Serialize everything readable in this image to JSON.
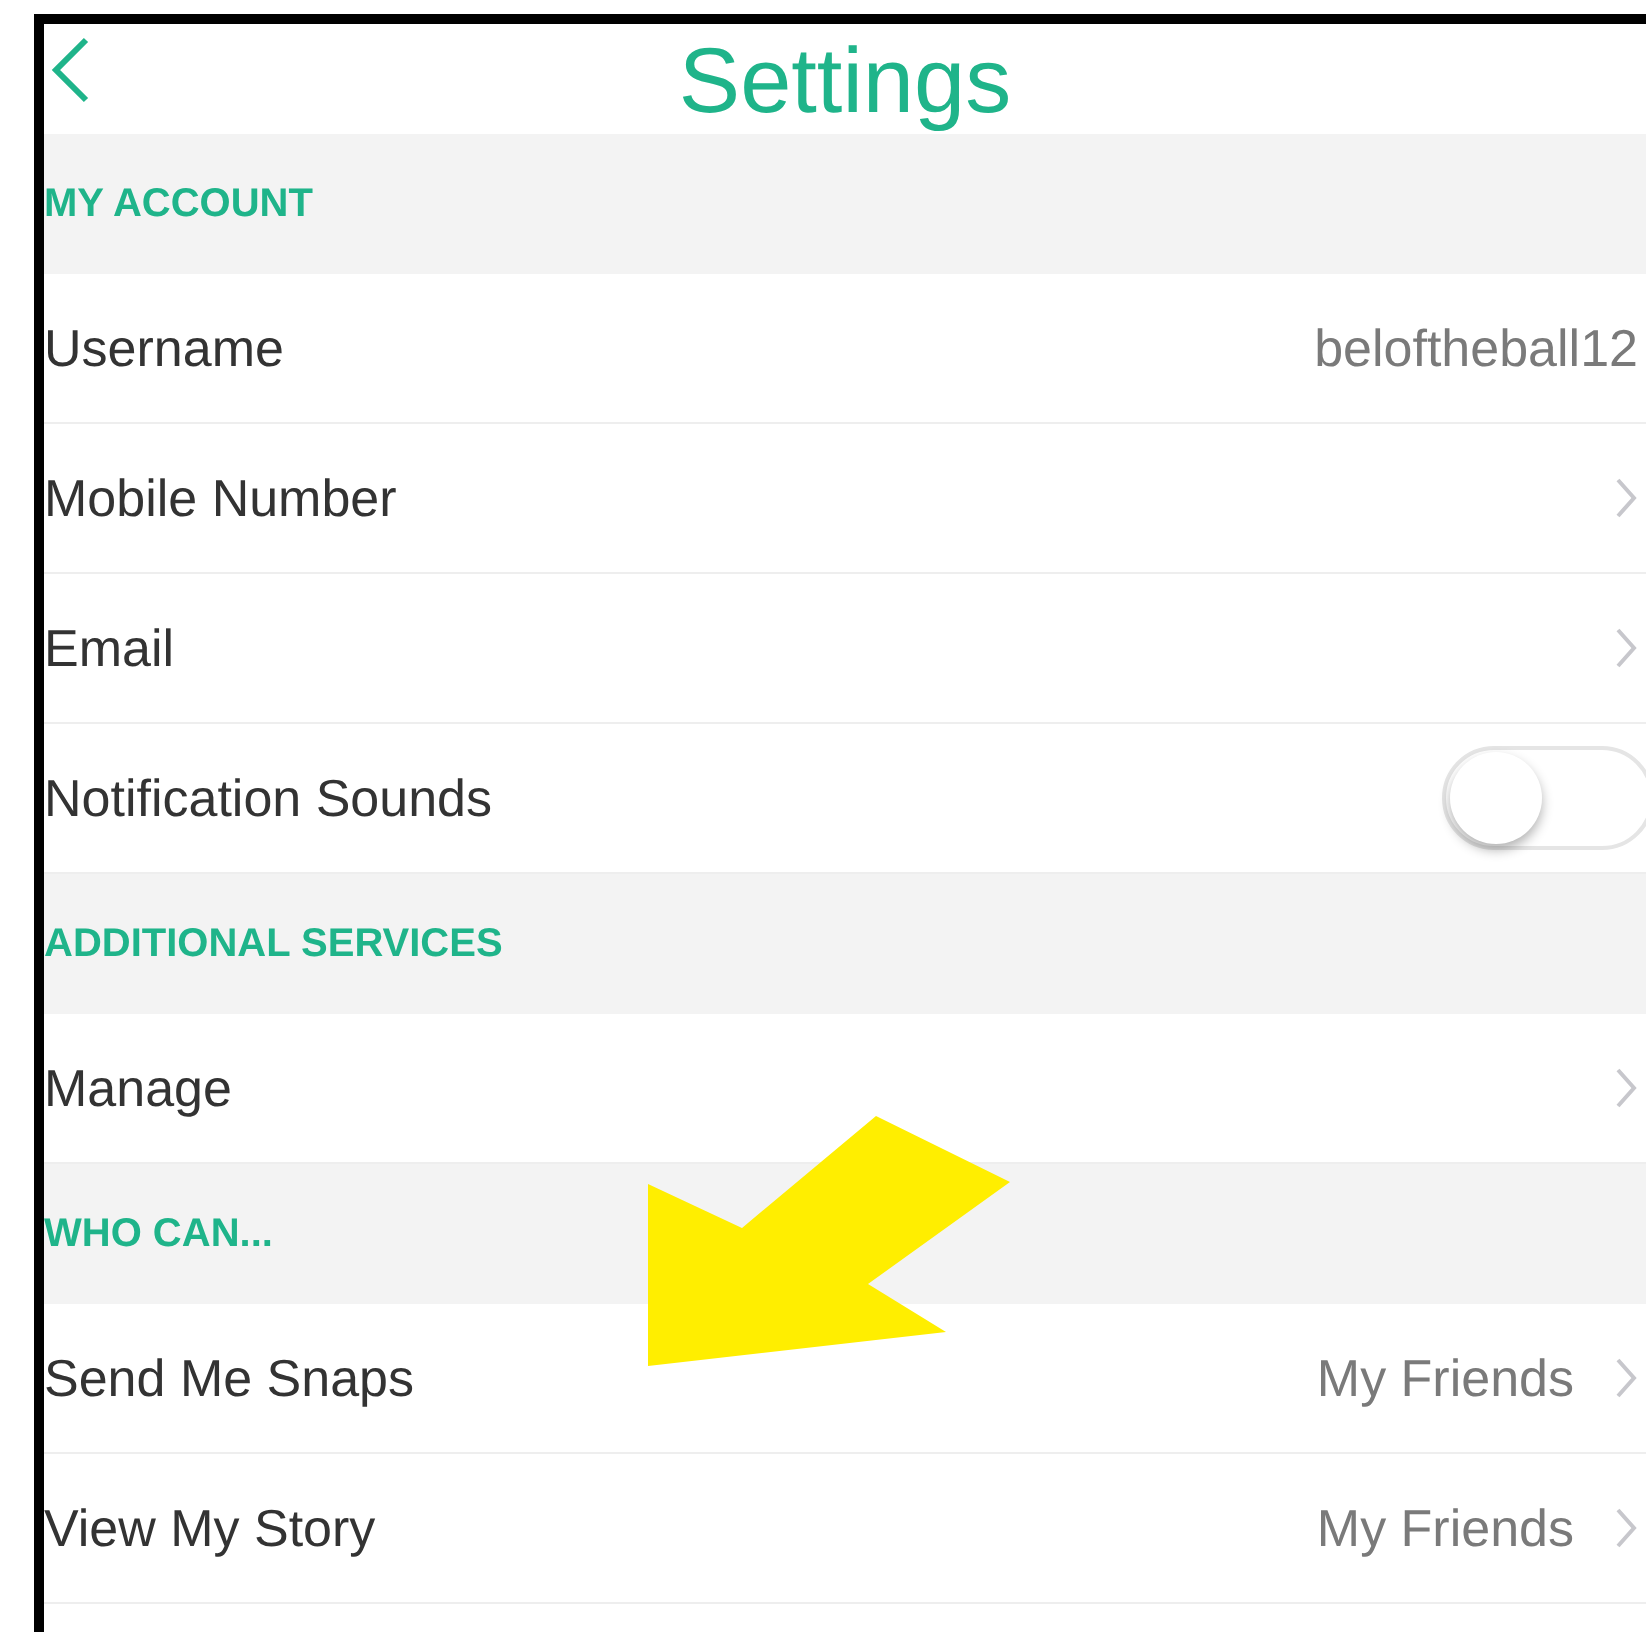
{
  "header": {
    "title": "Settings"
  },
  "sections": [
    {
      "title": "MY ACCOUNT",
      "rows": [
        {
          "kind": "value",
          "label": "Username",
          "value": "beloftheball12"
        },
        {
          "kind": "chevron",
          "label": "Mobile Number"
        },
        {
          "kind": "chevron",
          "label": "Email"
        },
        {
          "kind": "toggle",
          "label": "Notification Sounds",
          "on": false
        }
      ]
    },
    {
      "title": "ADDITIONAL SERVICES",
      "rows": [
        {
          "kind": "chevron",
          "label": "Manage"
        }
      ]
    },
    {
      "title": "WHO CAN...",
      "rows": [
        {
          "kind": "value_chevron",
          "label": "Send Me Snaps",
          "value": "My Friends"
        },
        {
          "kind": "value_chevron",
          "label": "View My Story",
          "value": "My Friends"
        }
      ]
    }
  ]
}
